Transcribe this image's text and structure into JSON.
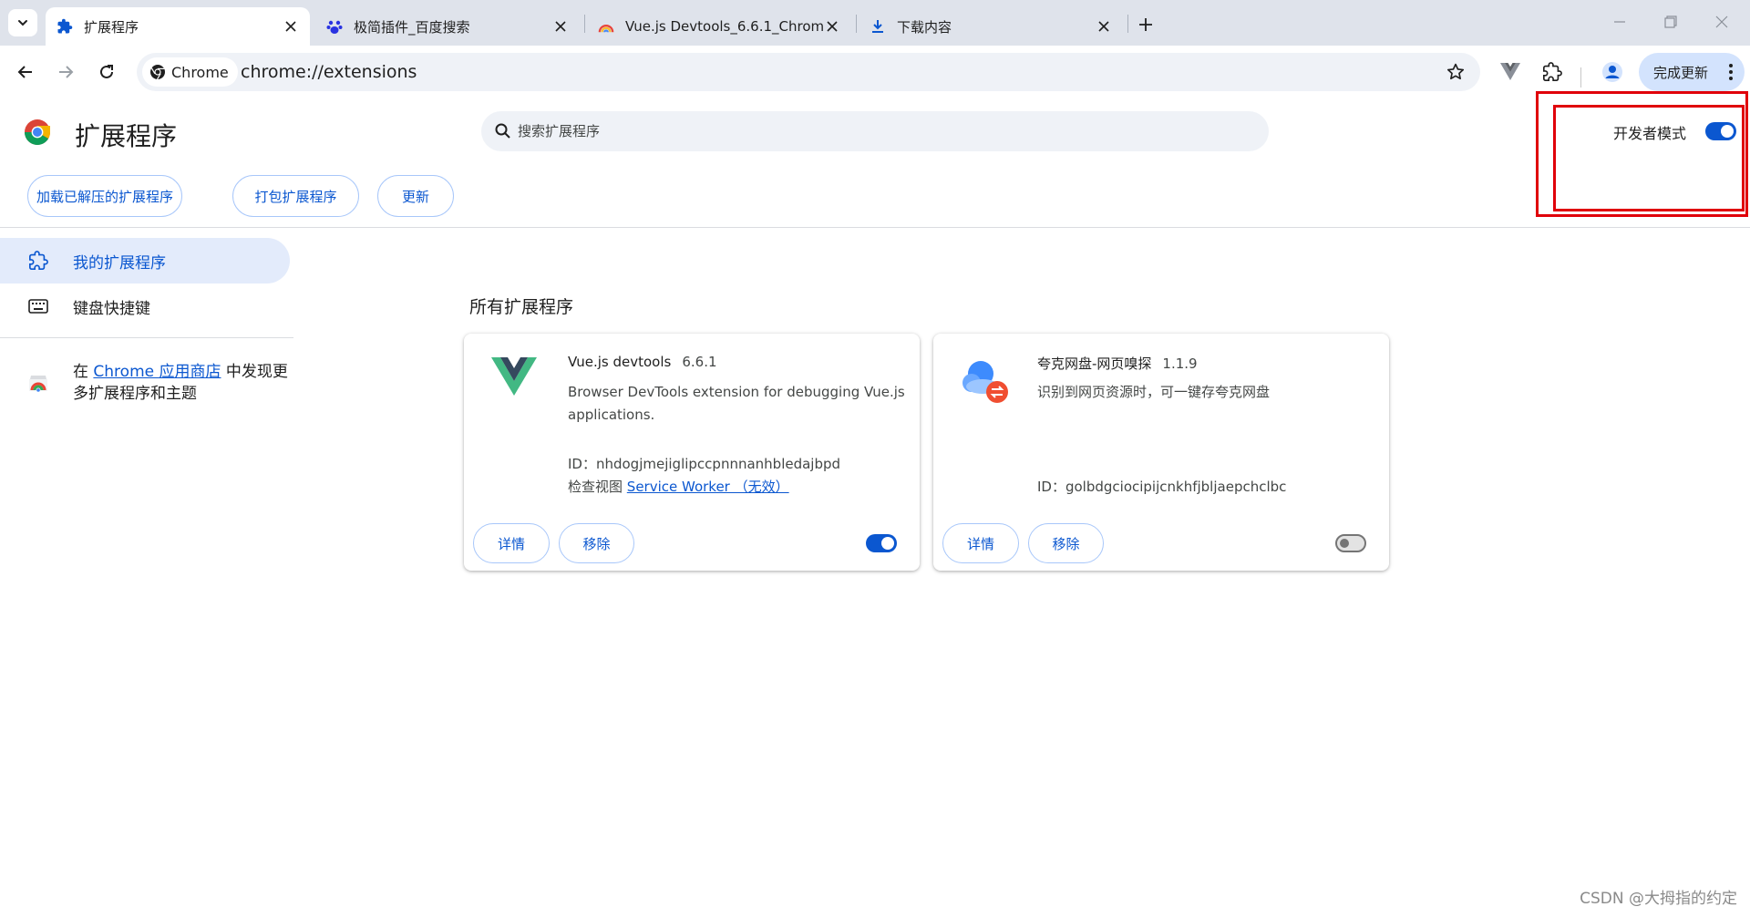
{
  "tabs": [
    {
      "title": "扩展程序",
      "active": true,
      "icon": "puzzle-icon"
    },
    {
      "title": "极简插件_百度搜索",
      "active": false,
      "icon": "baidu-paw-icon"
    },
    {
      "title": "Vue.js Devtools_6.6.1_Chrom",
      "active": false,
      "icon": "rainbow-icon"
    },
    {
      "title": "下载内容",
      "active": false,
      "icon": "download-icon"
    }
  ],
  "toolbar": {
    "chip_label": "Chrome",
    "url": "chrome://extensions",
    "update_label": "完成更新"
  },
  "header": {
    "title": "扩展程序",
    "search_placeholder": "搜索扩展程序",
    "dev_mode_label": "开发者模式",
    "dev_mode_on": true,
    "buttons": [
      "加载已解压的扩展程序",
      "打包扩展程序",
      "更新"
    ]
  },
  "sidebar": {
    "items": [
      {
        "label": "我的扩展程序",
        "active": true,
        "icon": "extensions-icon"
      },
      {
        "label": "键盘快捷键",
        "active": false,
        "icon": "keyboard-icon"
      }
    ],
    "promo_prefix": "在 ",
    "promo_link": "Chrome 应用商店",
    "promo_suffix": " 中发现更多扩展程序和主题"
  },
  "main": {
    "section_title": "所有扩展程序",
    "extensions": [
      {
        "name": "Vue.js devtools",
        "version": "6.6.1",
        "description": "Browser DevTools extension for debugging Vue.js applications.",
        "id_line": "ID：nhdogjmejiglipccpnnnanhbledajbpd",
        "inspect_label": "检查视图",
        "inspect_link": "Service Worker （无效）",
        "details_label": "详情",
        "remove_label": "移除",
        "enabled": true,
        "icon": "vue-logo-icon"
      },
      {
        "name": "夸克网盘-网页嗅探",
        "version": "1.1.9",
        "description": "识别到网页资源时，可一键存夸克网盘",
        "id_line": "ID：golbdgciocipijcnkhfjbljaepchclbc",
        "details_label": "详情",
        "remove_label": "移除",
        "enabled": false,
        "icon": "quark-cloud-icon"
      }
    ]
  },
  "watermark": "CSDN @大拇指的约定",
  "colors": {
    "accent": "#0b57d0",
    "tabstrip": "#dfe3eb",
    "highlight_box": "#e0000a"
  }
}
